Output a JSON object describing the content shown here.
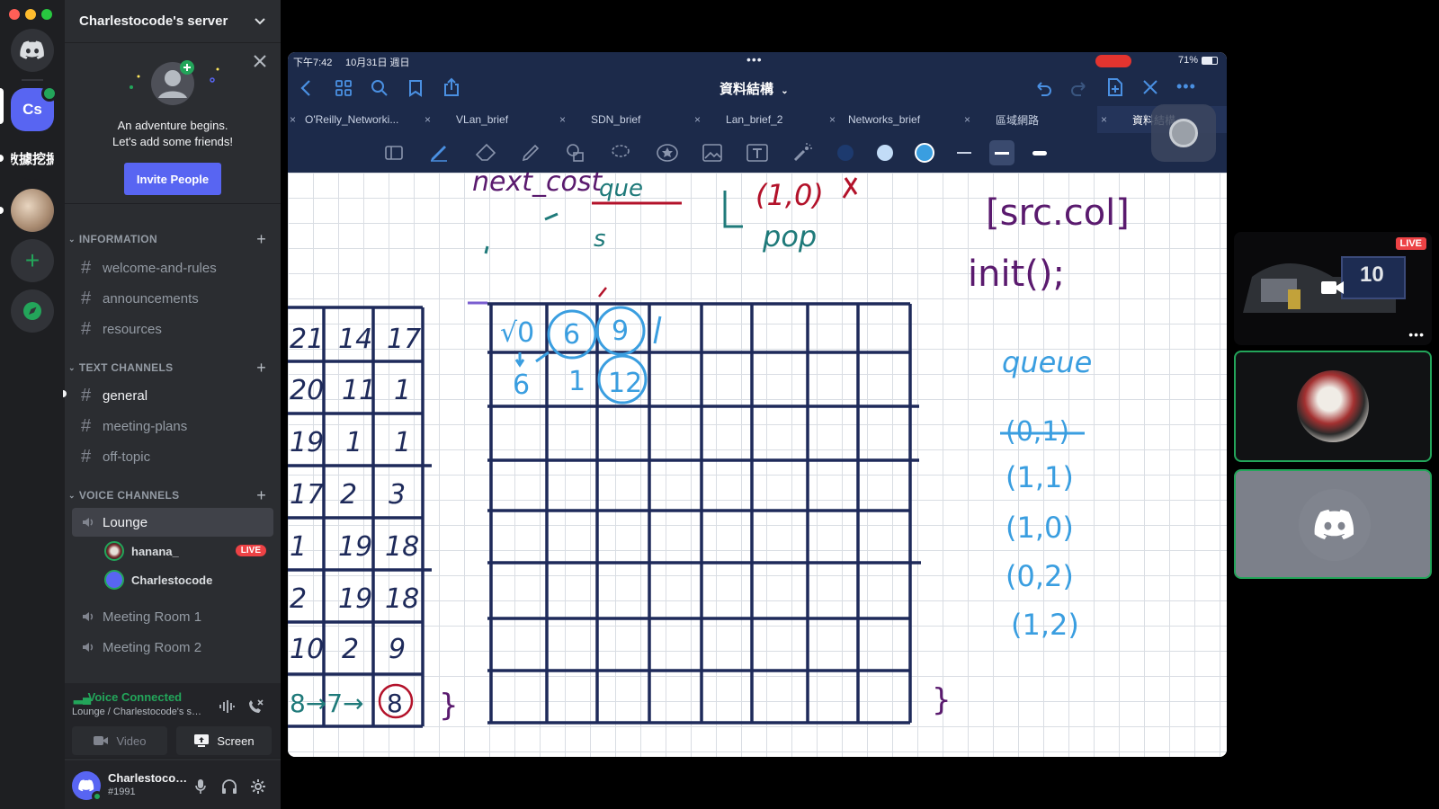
{
  "server": {
    "name": "Charlestocode's server",
    "icon_label": "Cs",
    "rail_label_2": "數據挖掘"
  },
  "invite": {
    "line1": "An adventure begins.",
    "line2": "Let's add some friends!",
    "button": "Invite People"
  },
  "categories": {
    "information": "INFORMATION",
    "text": "TEXT CHANNELS",
    "voice": "VOICE CHANNELS"
  },
  "info_channels": [
    "welcome-and-rules",
    "announcements",
    "resources"
  ],
  "text_channels": [
    "general",
    "meeting-plans",
    "off-topic"
  ],
  "voice_channels": {
    "lounge": "Lounge",
    "room1": "Meeting Room 1",
    "room2": "Meeting Room 2",
    "members": [
      {
        "name": "hanana_",
        "live": "LIVE"
      },
      {
        "name": "Charlestocode"
      }
    ]
  },
  "voice_panel": {
    "status": "Voice Connected",
    "sub": "Lounge / Charlestocode's server",
    "video": "Video",
    "screen": "Screen"
  },
  "user": {
    "name": "Charlestocode",
    "tag": "#1991"
  },
  "ipad": {
    "time": "下午7:42",
    "date": "10月31日 週日",
    "battery": "71%",
    "title": "資料結構",
    "tabs": [
      "O'Reilly_Networki...",
      "VLan_brief",
      "SDN_brief",
      "Lan_brief_2",
      "Networks_brief",
      "區域網路",
      "資料結構"
    ]
  },
  "tiles": {
    "live": "LIVE",
    "count": "10"
  },
  "colors": {
    "discord_blurple": "#5865f2",
    "live_red": "#ed4245",
    "connected_green": "#23a55a",
    "ink_navy": "#1e2a5a",
    "ink_purple": "#5a1a6e",
    "ink_teal": "#1f7a7a",
    "ink_red": "#b3122a",
    "ink_blue": "#3a9ee0"
  }
}
